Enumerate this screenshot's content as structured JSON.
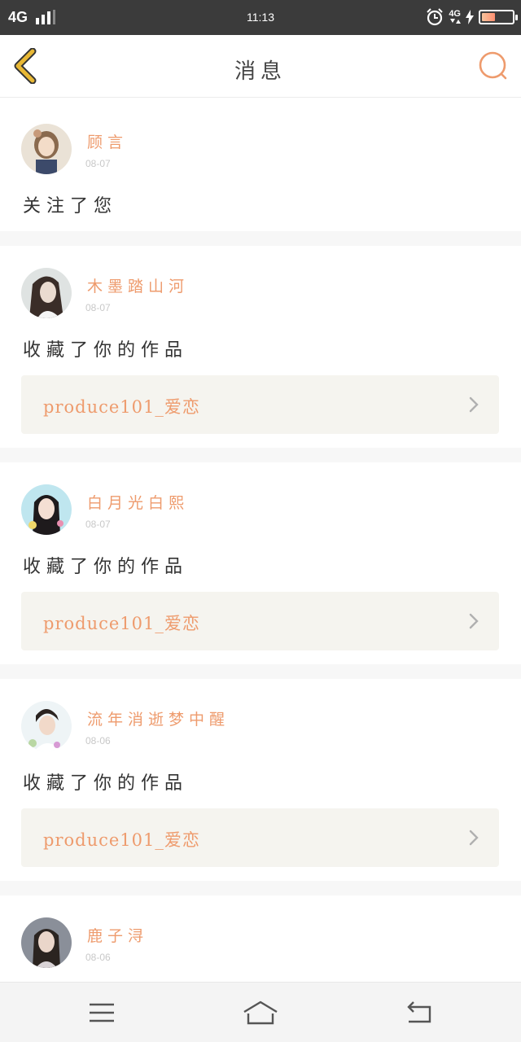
{
  "status_bar": {
    "network": "4G",
    "time": "11:13",
    "network_right": "4G"
  },
  "header": {
    "title": "消息",
    "back_icon": "chevron-left-icon",
    "search_icon": "search-icon"
  },
  "colors": {
    "accent": "#ee9b6d",
    "back_arrow": "#e8b835",
    "work_bg": "#f5f4ef"
  },
  "notifications": [
    {
      "user": "顾言",
      "date": "08-07",
      "action": "关注了您",
      "work": null
    },
    {
      "user": "木墨踏山河",
      "date": "08-07",
      "action": "收藏了你的作品",
      "work": "produce101_爱恋"
    },
    {
      "user": "白月光白熙",
      "date": "08-07",
      "action": "收藏了你的作品",
      "work": "produce101_爱恋"
    },
    {
      "user": "流年消逝梦中醒",
      "date": "08-06",
      "action": "收藏了你的作品",
      "work": "produce101_爱恋"
    },
    {
      "user": "鹿子浔",
      "date": "08-06"
    }
  ],
  "nav": {
    "menu_icon": "menu-icon",
    "home_icon": "home-icon",
    "back_icon": "return-icon"
  }
}
